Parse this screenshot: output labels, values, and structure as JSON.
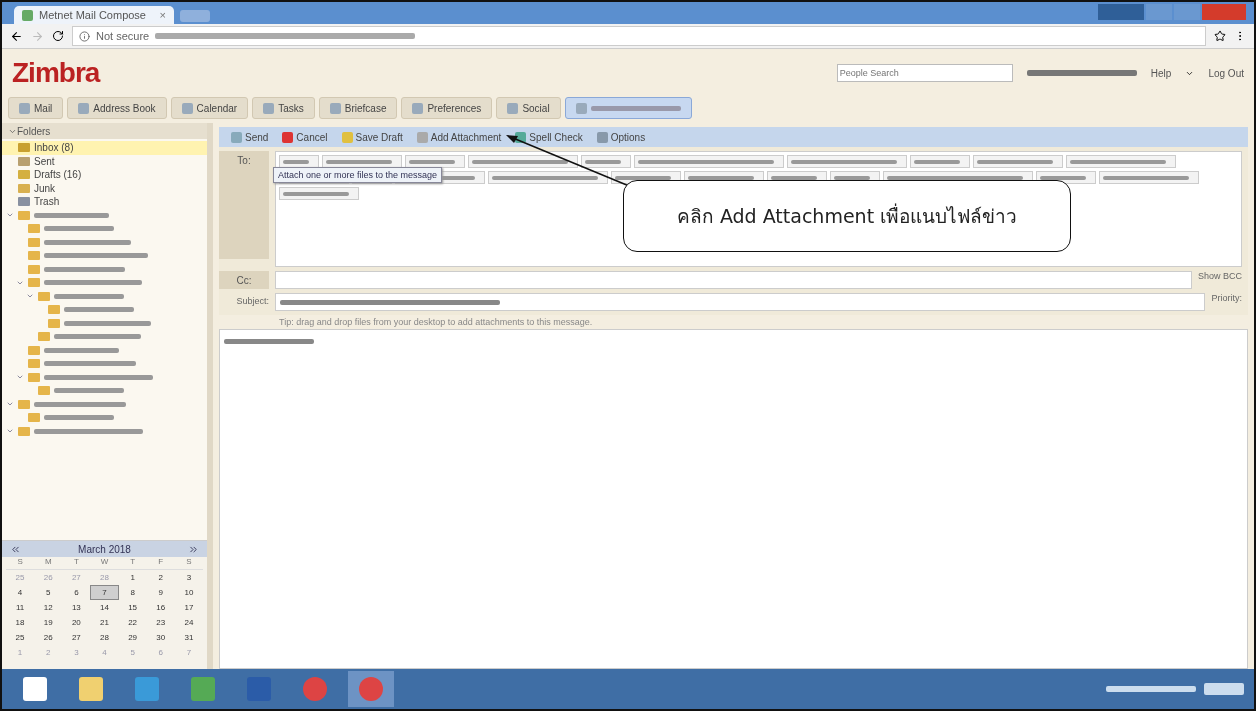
{
  "browser": {
    "tab_title": "Metnet Mail Compose",
    "tab_close": "×",
    "security": "Not secure"
  },
  "header": {
    "logo": "Zimbra",
    "search_placeholder": "People Search",
    "help": "Help",
    "logout": "Log Out"
  },
  "app_tabs": [
    {
      "label": "Mail",
      "selected": false
    },
    {
      "label": "Address Book",
      "selected": false
    },
    {
      "label": "Calendar",
      "selected": false
    },
    {
      "label": "Tasks",
      "selected": false
    },
    {
      "label": "Briefcase",
      "selected": false
    },
    {
      "label": "Preferences",
      "selected": false
    },
    {
      "label": "Social",
      "selected": false
    },
    {
      "selected": true
    }
  ],
  "toolbar": [
    {
      "label": "Send",
      "kind": "send"
    },
    {
      "label": "Cancel",
      "kind": "cancel"
    },
    {
      "label": "Save Draft",
      "kind": "draft"
    },
    {
      "label": "Add Attachment",
      "kind": "attach"
    },
    {
      "label": "Spell Check",
      "kind": "spell"
    },
    {
      "label": "Options",
      "kind": "options"
    }
  ],
  "tooltip": "Attach one or more files to the message",
  "compose": {
    "to_label": "To:",
    "cc_label": "Cc:",
    "show_bcc": "Show BCC",
    "subject_label": "Subject:",
    "priority_label": "Priority:",
    "hint": "Tip: drag and drop files from your desktop to add attachments to this message."
  },
  "callout": "คลิก Add Attachment เพื่อแนบไฟล์ข่าว",
  "folders": {
    "title": "Folders",
    "items": [
      {
        "label": "Inbox (8)",
        "kind": "inbox",
        "selected": true
      },
      {
        "label": "Sent",
        "kind": "sent",
        "selected": false
      },
      {
        "label": "Drafts (16)",
        "kind": "drafts",
        "selected": false
      },
      {
        "label": "Junk",
        "kind": "junk",
        "selected": false
      },
      {
        "label": "Trash",
        "kind": "trash",
        "selected": false
      },
      {
        "selected": false,
        "expanded": true,
        "children": [
          {
            "selected": false
          },
          {
            "selected": false
          },
          {
            "selected": false
          },
          {
            "selected": false
          },
          {
            "selected": false,
            "expanded": true,
            "children": [
              {
                "selected": false,
                "expanded": true,
                "children": [
                  {
                    "selected": false
                  },
                  {
                    "selected": false
                  }
                ]
              },
              {
                "selected": false
              }
            ]
          },
          {
            "selected": false
          },
          {
            "selected": false
          },
          {
            "selected": false,
            "expanded": true,
            "children": [
              {
                "selected": false
              }
            ]
          }
        ]
      },
      {
        "selected": false,
        "expanded": true,
        "children": [
          {
            "selected": false
          }
        ]
      },
      {
        "selected": false,
        "expanded": true
      }
    ]
  },
  "calendar": {
    "title": "March 2018",
    "weekdays": [
      "S",
      "M",
      "T",
      "W",
      "T",
      "F",
      "S"
    ],
    "days": [
      {
        "label": "25",
        "other": true,
        "selected": false
      },
      {
        "label": "26",
        "other": true,
        "selected": false
      },
      {
        "label": "27",
        "other": true,
        "selected": false
      },
      {
        "label": "28",
        "other": true,
        "selected": false
      },
      {
        "label": "1",
        "other": false,
        "selected": false
      },
      {
        "label": "2",
        "other": false,
        "selected": false
      },
      {
        "label": "3",
        "other": false,
        "selected": false
      },
      {
        "label": "4",
        "other": false,
        "selected": false
      },
      {
        "label": "5",
        "other": false,
        "selected": false
      },
      {
        "label": "6",
        "other": false,
        "selected": false
      },
      {
        "label": "7",
        "other": false,
        "selected": true
      },
      {
        "label": "8",
        "other": false,
        "selected": false
      },
      {
        "label": "9",
        "other": false,
        "selected": false
      },
      {
        "label": "10",
        "other": false,
        "selected": false
      },
      {
        "label": "11",
        "other": false,
        "selected": false
      },
      {
        "label": "12",
        "other": false,
        "selected": false
      },
      {
        "label": "13",
        "other": false,
        "selected": false
      },
      {
        "label": "14",
        "other": false,
        "selected": false
      },
      {
        "label": "15",
        "other": false,
        "selected": false
      },
      {
        "label": "16",
        "other": false,
        "selected": false
      },
      {
        "label": "17",
        "other": false,
        "selected": false
      },
      {
        "label": "18",
        "other": false,
        "selected": false
      },
      {
        "label": "19",
        "other": false,
        "selected": false
      },
      {
        "label": "20",
        "other": false,
        "selected": false
      },
      {
        "label": "21",
        "other": false,
        "selected": false
      },
      {
        "label": "22",
        "other": false,
        "selected": false
      },
      {
        "label": "23",
        "other": false,
        "selected": false
      },
      {
        "label": "24",
        "other": false,
        "selected": false
      },
      {
        "label": "25",
        "other": false,
        "selected": false
      },
      {
        "label": "26",
        "other": false,
        "selected": false
      },
      {
        "label": "27",
        "other": false,
        "selected": false
      },
      {
        "label": "28",
        "other": false,
        "selected": false
      },
      {
        "label": "29",
        "other": false,
        "selected": false
      },
      {
        "label": "30",
        "other": false,
        "selected": false
      },
      {
        "label": "31",
        "other": false,
        "selected": false
      },
      {
        "label": "1",
        "other": true,
        "selected": false
      },
      {
        "label": "2",
        "other": true,
        "selected": false
      },
      {
        "label": "3",
        "other": true,
        "selected": false
      },
      {
        "label": "4",
        "other": true,
        "selected": false
      },
      {
        "label": "5",
        "other": true,
        "selected": false
      },
      {
        "label": "6",
        "other": true,
        "selected": false
      },
      {
        "label": "7",
        "other": true,
        "selected": false
      }
    ]
  },
  "taskbar": [
    {
      "kind": "start",
      "selected": false
    },
    {
      "kind": "explorer",
      "selected": false
    },
    {
      "kind": "ie",
      "selected": false
    },
    {
      "kind": "app",
      "selected": false
    },
    {
      "kind": "word",
      "selected": false
    },
    {
      "kind": "chrome",
      "selected": false
    },
    {
      "kind": "chrome",
      "selected": true
    }
  ]
}
